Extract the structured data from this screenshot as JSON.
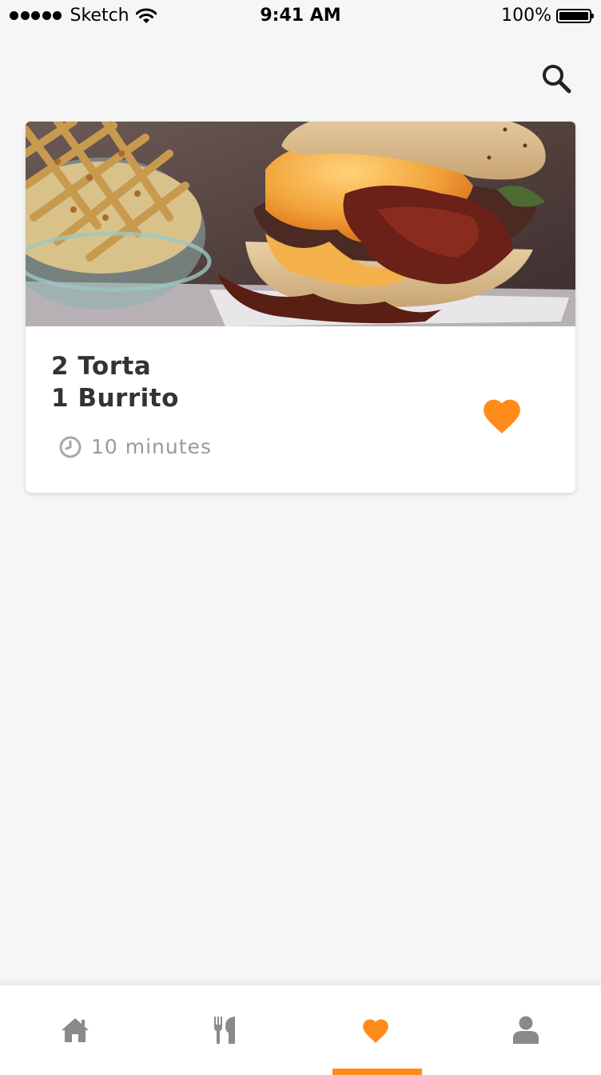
{
  "status_bar": {
    "carrier": "Sketch",
    "time": "9:41 AM",
    "battery": "100%"
  },
  "header": {
    "search_icon": "search-icon"
  },
  "card": {
    "image": "burger-and-fries-photo",
    "title_line1": "2 Torta",
    "title_line2": "1 Burrito",
    "time_icon": "clock-icon",
    "time_label": "10 minutes",
    "favorite_icon": "heart-icon"
  },
  "tab_bar": {
    "tabs": [
      {
        "icon": "home-icon",
        "active": false
      },
      {
        "icon": "cutlery-icon",
        "active": false
      },
      {
        "icon": "heart-icon",
        "active": true
      },
      {
        "icon": "user-icon",
        "active": false
      }
    ]
  },
  "colors": {
    "accent": "#ff8c1a",
    "background": "#f6f6f6",
    "title_text": "#333333",
    "secondary_text": "#9a9a9a",
    "inactive_icon": "#8a8a8a"
  }
}
